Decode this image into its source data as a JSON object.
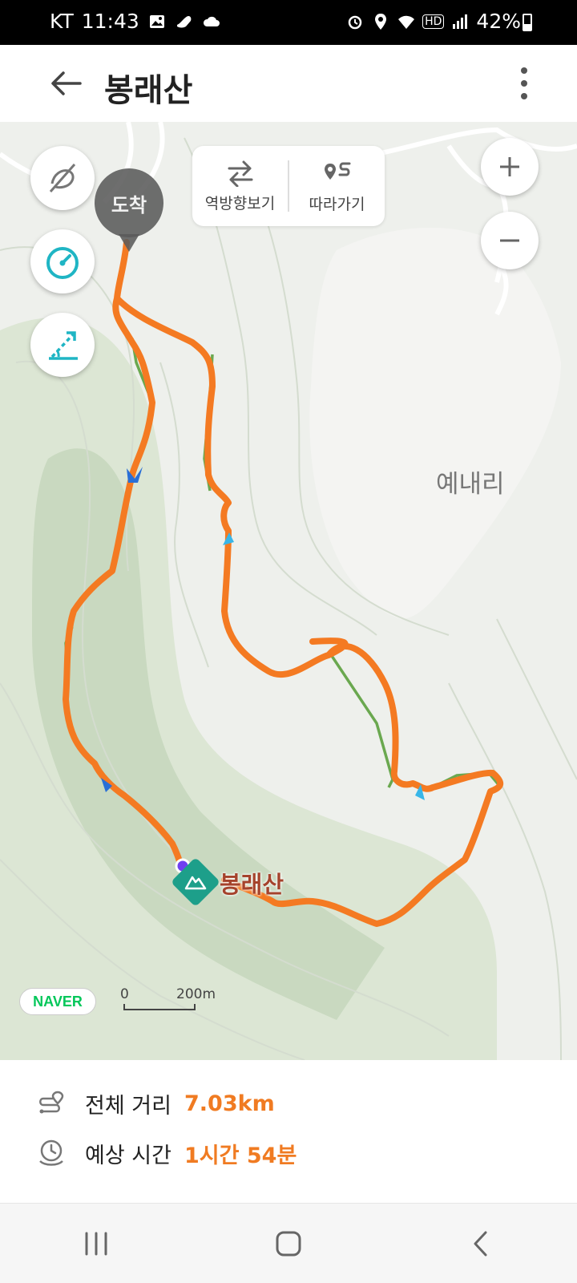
{
  "status_bar": {
    "carrier": "KT",
    "time": "11:43",
    "hd_label": "HD",
    "wifi_badge": "6",
    "battery": "42%"
  },
  "header": {
    "title": "봉래산"
  },
  "map": {
    "route_tools": [
      {
        "label": "역방향보기",
        "icon": "swap-arrows-icon"
      },
      {
        "label": "따라가기",
        "icon": "follow-route-icon"
      }
    ],
    "arrival_label": "도착",
    "place_label": "예내리",
    "peak_label": "봉래산",
    "provider": "NAVER",
    "scale": {
      "start": "0",
      "end": "200m"
    },
    "colors": {
      "route": "#f47a22",
      "trail": "#6aa84f",
      "accent": "#1fb5c4"
    }
  },
  "summary": {
    "distance_label": "전체 거리",
    "distance_value": "7.03km",
    "time_label": "예상 시간",
    "time_value": "1시간 54분"
  }
}
